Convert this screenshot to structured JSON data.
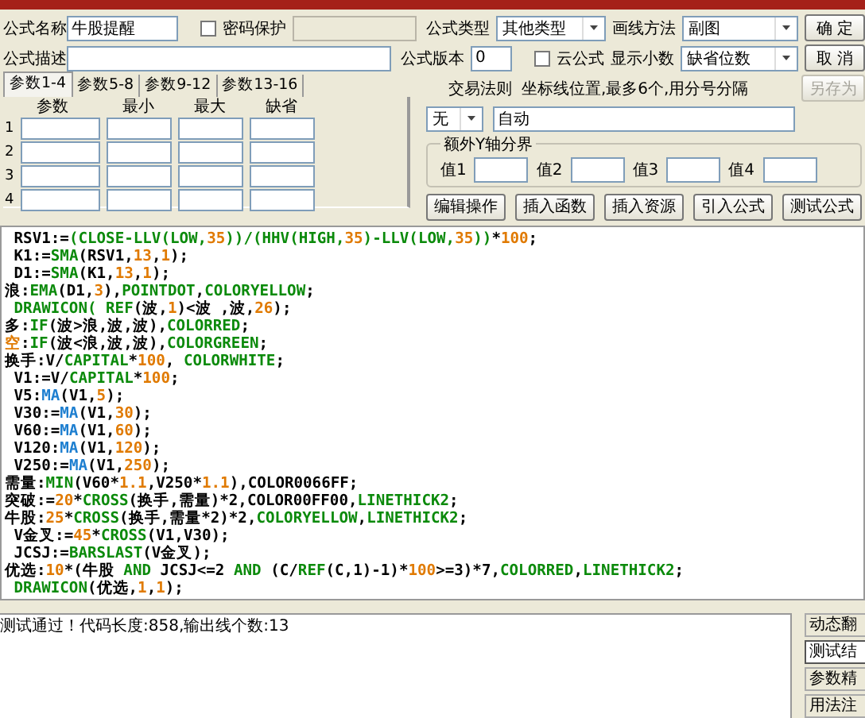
{
  "form": {
    "name_label": "公式名称",
    "name_value": "牛股提醒",
    "password": {
      "label": "密码保护",
      "checked": false
    },
    "type_label": "公式类型",
    "type_value": "其他类型",
    "draw_label": "画线方法",
    "draw_value": "副图",
    "desc_label": "公式描述",
    "version_label": "公式版本",
    "version_value": "0",
    "cloud": {
      "label": "云公式",
      "checked": false
    },
    "decimals_label": "显示小数",
    "decimals_value": "缺省位数"
  },
  "buttons": [
    {
      "label": "确 定",
      "disabled": false
    },
    {
      "label": "取 消",
      "disabled": false
    },
    {
      "label": "另存为",
      "disabled": true
    }
  ],
  "tabs": [
    {
      "label": "参数1-4",
      "selected": true
    },
    {
      "label": "参数5-8",
      "selected": false
    },
    {
      "label": "参数9-12",
      "selected": false
    },
    {
      "label": "参数13-16",
      "selected": false
    }
  ],
  "param_columns": [
    "参数",
    "最小",
    "最大",
    "缺省"
  ],
  "param_rows": [
    "1",
    "2",
    "3",
    "4"
  ],
  "trade_rule": {
    "label": "交易法则",
    "value": "无"
  },
  "axis": {
    "label": "坐标线位置,最多6个,用分号分隔",
    "value": "自动"
  },
  "y_bounds": {
    "title": "额外Y轴分界",
    "fields": [
      "值1",
      "值2",
      "值3",
      "值4"
    ]
  },
  "tools": [
    "编辑操作",
    "插入函数",
    "插入资源",
    "引入公式",
    "测试公式"
  ],
  "code_lines": [
    [
      {
        "kind": "plain",
        "text": " RSV1:="
      },
      {
        "kind": "func",
        "text": "(CLOSE-LLV(LOW,"
      },
      {
        "kind": "num",
        "text": "35"
      },
      {
        "kind": "func",
        "text": "))/(HHV(HIGH,"
      },
      {
        "kind": "num",
        "text": "35"
      },
      {
        "kind": "func",
        "text": ")-LLV(LOW,"
      },
      {
        "kind": "num",
        "text": "35"
      },
      {
        "kind": "func",
        "text": "))"
      },
      {
        "kind": "plain",
        "text": "*"
      },
      {
        "kind": "num",
        "text": "100"
      },
      {
        "kind": "plain",
        "text": ";"
      }
    ],
    [
      {
        "kind": "plain",
        "text": " K1:="
      },
      {
        "kind": "func",
        "text": "SMA"
      },
      {
        "kind": "plain",
        "text": "(RSV1,"
      },
      {
        "kind": "num",
        "text": "13"
      },
      {
        "kind": "plain",
        "text": ","
      },
      {
        "kind": "num",
        "text": "1"
      },
      {
        "kind": "plain",
        "text": ");"
      }
    ],
    [
      {
        "kind": "plain",
        "text": " D1:="
      },
      {
        "kind": "func",
        "text": "SMA"
      },
      {
        "kind": "plain",
        "text": "(K1,"
      },
      {
        "kind": "num",
        "text": "13"
      },
      {
        "kind": "plain",
        "text": ","
      },
      {
        "kind": "num",
        "text": "1"
      },
      {
        "kind": "plain",
        "text": ");"
      }
    ],
    [
      {
        "kind": "plain",
        "text": "浪:"
      },
      {
        "kind": "func",
        "text": "EMA"
      },
      {
        "kind": "plain",
        "text": "(D1,"
      },
      {
        "kind": "num",
        "text": "3"
      },
      {
        "kind": "plain",
        "text": "),"
      },
      {
        "kind": "func",
        "text": "POINTDOT"
      },
      {
        "kind": "plain",
        "text": ","
      },
      {
        "kind": "func",
        "text": "COLORYELLOW"
      },
      {
        "kind": "plain",
        "text": ";"
      }
    ],
    [
      {
        "kind": "func",
        "text": " DRAWICON( REF"
      },
      {
        "kind": "plain",
        "text": "(波,"
      },
      {
        "kind": "num",
        "text": "1"
      },
      {
        "kind": "plain",
        "text": ")<波 ,波,"
      },
      {
        "kind": "num",
        "text": "26"
      },
      {
        "kind": "plain",
        "text": ");"
      }
    ],
    [
      {
        "kind": "plain",
        "text": "多:"
      },
      {
        "kind": "func",
        "text": "IF"
      },
      {
        "kind": "plain",
        "text": "(波>浪,波,波),"
      },
      {
        "kind": "func",
        "text": "COLORRED"
      },
      {
        "kind": "plain",
        "text": ";"
      }
    ],
    [
      {
        "kind": "num",
        "text": "空"
      },
      {
        "kind": "plain",
        "text": ":"
      },
      {
        "kind": "func",
        "text": "IF"
      },
      {
        "kind": "plain",
        "text": "(波<浪,波,波),"
      },
      {
        "kind": "func",
        "text": "COLORGREEN"
      },
      {
        "kind": "plain",
        "text": ";"
      }
    ],
    [
      {
        "kind": "plain",
        "text": "换手:V/"
      },
      {
        "kind": "func",
        "text": "CAPITAL"
      },
      {
        "kind": "plain",
        "text": "*"
      },
      {
        "kind": "num",
        "text": "100"
      },
      {
        "kind": "plain",
        "text": ", "
      },
      {
        "kind": "func",
        "text": "COLORWHITE"
      },
      {
        "kind": "plain",
        "text": ";"
      }
    ],
    [
      {
        "kind": "plain",
        "text": " V1:=V/"
      },
      {
        "kind": "func",
        "text": "CAPITAL"
      },
      {
        "kind": "plain",
        "text": "*"
      },
      {
        "kind": "num",
        "text": "100"
      },
      {
        "kind": "plain",
        "text": ";"
      }
    ],
    [
      {
        "kind": "plain",
        "text": " V5:"
      },
      {
        "kind": "ma",
        "text": "MA"
      },
      {
        "kind": "plain",
        "text": "(V1,"
      },
      {
        "kind": "num",
        "text": "5"
      },
      {
        "kind": "plain",
        "text": ");"
      }
    ],
    [
      {
        "kind": "plain",
        "text": " V30:="
      },
      {
        "kind": "ma",
        "text": "MA"
      },
      {
        "kind": "plain",
        "text": "(V1,"
      },
      {
        "kind": "num",
        "text": "30"
      },
      {
        "kind": "plain",
        "text": ");"
      }
    ],
    [
      {
        "kind": "plain",
        "text": " V60:="
      },
      {
        "kind": "ma",
        "text": "MA"
      },
      {
        "kind": "plain",
        "text": "(V1,"
      },
      {
        "kind": "num",
        "text": "60"
      },
      {
        "kind": "plain",
        "text": ");"
      }
    ],
    [
      {
        "kind": "plain",
        "text": " V120:"
      },
      {
        "kind": "ma",
        "text": "MA"
      },
      {
        "kind": "plain",
        "text": "(V1,"
      },
      {
        "kind": "num",
        "text": "120"
      },
      {
        "kind": "plain",
        "text": ");"
      }
    ],
    [
      {
        "kind": "plain",
        "text": " V250:="
      },
      {
        "kind": "ma",
        "text": "MA"
      },
      {
        "kind": "plain",
        "text": "(V1,"
      },
      {
        "kind": "num",
        "text": "250"
      },
      {
        "kind": "plain",
        "text": ");"
      }
    ],
    [
      {
        "kind": "plain",
        "text": "需量:"
      },
      {
        "kind": "func",
        "text": "MIN"
      },
      {
        "kind": "plain",
        "text": "(V60*"
      },
      {
        "kind": "num",
        "text": "1.1"
      },
      {
        "kind": "plain",
        "text": ",V250*"
      },
      {
        "kind": "num",
        "text": "1.1"
      },
      {
        "kind": "plain",
        "text": "),COLOR0066FF;"
      }
    ],
    [
      {
        "kind": "plain",
        "text": "突破:="
      },
      {
        "kind": "num",
        "text": "20"
      },
      {
        "kind": "plain",
        "text": "*"
      },
      {
        "kind": "func",
        "text": "CROSS"
      },
      {
        "kind": "plain",
        "text": "(换手,需量)*2,COLOR00FF00,"
      },
      {
        "kind": "func",
        "text": "LINETHICK2"
      },
      {
        "kind": "plain",
        "text": ";"
      }
    ],
    [
      {
        "kind": "plain",
        "text": "牛股:"
      },
      {
        "kind": "num",
        "text": "25"
      },
      {
        "kind": "plain",
        "text": "*"
      },
      {
        "kind": "func",
        "text": "CROSS"
      },
      {
        "kind": "plain",
        "text": "(换手,需量*2)*2,"
      },
      {
        "kind": "func",
        "text": "COLORYELLOW"
      },
      {
        "kind": "plain",
        "text": ","
      },
      {
        "kind": "func",
        "text": "LINETHICK2"
      },
      {
        "kind": "plain",
        "text": ";"
      }
    ],
    [
      {
        "kind": "plain",
        "text": " V金叉:="
      },
      {
        "kind": "num",
        "text": "45"
      },
      {
        "kind": "plain",
        "text": "*"
      },
      {
        "kind": "func",
        "text": "CROSS"
      },
      {
        "kind": "plain",
        "text": "(V1,V30);"
      }
    ],
    [
      {
        "kind": "plain",
        "text": " JCSJ:="
      },
      {
        "kind": "func",
        "text": "BARSLAST"
      },
      {
        "kind": "plain",
        "text": "(V金叉);"
      }
    ],
    [
      {
        "kind": "plain",
        "text": "优选:"
      },
      {
        "kind": "num",
        "text": "10"
      },
      {
        "kind": "plain",
        "text": "*(牛股 "
      },
      {
        "kind": "func",
        "text": "AND"
      },
      {
        "kind": "plain",
        "text": " JCSJ<=2 "
      },
      {
        "kind": "func",
        "text": "AND"
      },
      {
        "kind": "plain",
        "text": " (C/"
      },
      {
        "kind": "func",
        "text": "REF"
      },
      {
        "kind": "plain",
        "text": "(C,1)-1)*"
      },
      {
        "kind": "num",
        "text": "100"
      },
      {
        "kind": "plain",
        "text": ">=3)*7,"
      },
      {
        "kind": "func",
        "text": "COLORRED"
      },
      {
        "kind": "plain",
        "text": ","
      },
      {
        "kind": "func",
        "text": "LINETHICK2"
      },
      {
        "kind": "plain",
        "text": ";"
      }
    ],
    [
      {
        "kind": "func",
        "text": " DRAWICON"
      },
      {
        "kind": "plain",
        "text": "(优选,"
      },
      {
        "kind": "num",
        "text": "1"
      },
      {
        "kind": "plain",
        "text": ","
      },
      {
        "kind": "num",
        "text": "1"
      },
      {
        "kind": "plain",
        "text": ");"
      }
    ]
  ],
  "output": "测试通过！代码长度:858,输出线个数:13",
  "side_tabs": [
    {
      "label": "动态翻",
      "selected": false
    },
    {
      "label": "测试结",
      "selected": true
    },
    {
      "label": "参数精",
      "selected": false
    },
    {
      "label": "用法注",
      "selected": false
    }
  ]
}
